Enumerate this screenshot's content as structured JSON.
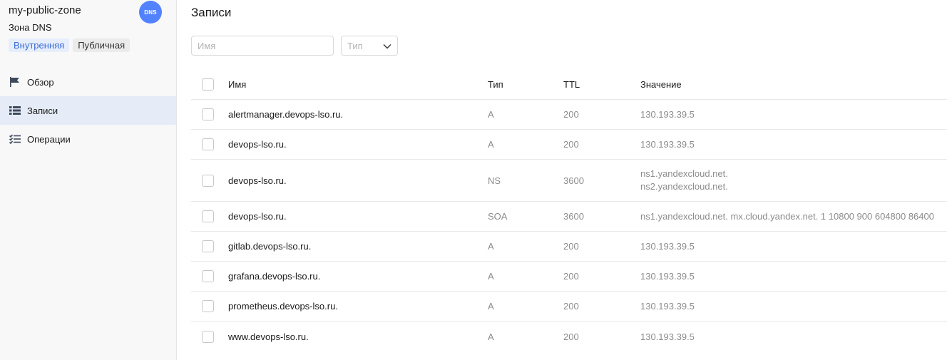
{
  "sidebar": {
    "zone_name": "my-public-zone",
    "zone_subtitle": "Зона DNS",
    "badge": "DNS",
    "tags": [
      "Внутренняя",
      "Публичная"
    ],
    "nav": [
      {
        "label": "Обзор",
        "icon": "flag-icon"
      },
      {
        "label": "Записи",
        "icon": "list-icon",
        "active": true
      },
      {
        "label": "Операции",
        "icon": "checklist-icon"
      }
    ]
  },
  "main": {
    "title": "Записи",
    "filters": {
      "name_placeholder": "Имя",
      "type_placeholder": "Тип"
    },
    "table": {
      "columns": [
        "Имя",
        "Тип",
        "TTL",
        "Значение"
      ],
      "rows": [
        {
          "name": "alertmanager.devops-lso.ru.",
          "type": "A",
          "ttl": "200",
          "value": [
            "130.193.39.5"
          ]
        },
        {
          "name": "devops-lso.ru.",
          "type": "A",
          "ttl": "200",
          "value": [
            "130.193.39.5"
          ]
        },
        {
          "name": "devops-lso.ru.",
          "type": "NS",
          "ttl": "3600",
          "value": [
            "ns1.yandexcloud.net.",
            "ns2.yandexcloud.net."
          ]
        },
        {
          "name": "devops-lso.ru.",
          "type": "SOA",
          "ttl": "3600",
          "value": [
            "ns1.yandexcloud.net. mx.cloud.yandex.net. 1 10800 900 604800 86400"
          ]
        },
        {
          "name": "gitlab.devops-lso.ru.",
          "type": "A",
          "ttl": "200",
          "value": [
            "130.193.39.5"
          ]
        },
        {
          "name": "grafana.devops-lso.ru.",
          "type": "A",
          "ttl": "200",
          "value": [
            "130.193.39.5"
          ]
        },
        {
          "name": "prometheus.devops-lso.ru.",
          "type": "A",
          "ttl": "200",
          "value": [
            "130.193.39.5"
          ]
        },
        {
          "name": "www.devops-lso.ru.",
          "type": "A",
          "ttl": "200",
          "value": [
            "130.193.39.5"
          ]
        }
      ]
    }
  },
  "colors": {
    "accent": "#5282ff",
    "active_nav_bg": "#e5ecf7",
    "muted_text": "#8c8c8c"
  }
}
